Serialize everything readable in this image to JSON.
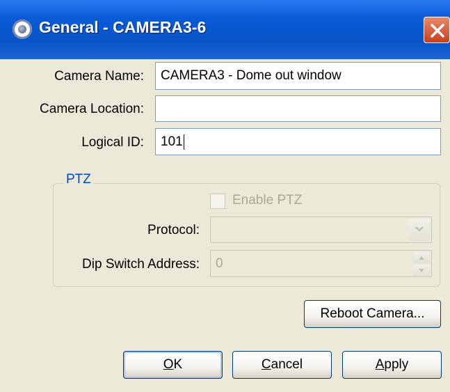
{
  "window": {
    "title": "General - CAMERA3-6",
    "icon": "camera-icon",
    "close_icon": "close-icon"
  },
  "form": {
    "camera_name_label": "Camera Name:",
    "camera_name_value": "CAMERA3 - Dome out window",
    "camera_location_label": "Camera Location:",
    "camera_location_value": "",
    "logical_id_label": "Logical ID:",
    "logical_id_value": "101"
  },
  "ptz": {
    "group_label": "PTZ",
    "enable_label": "Enable PTZ",
    "enable_checked": false,
    "protocol_label": "Protocol:",
    "protocol_value": "",
    "dip_label": "Dip Switch Address:",
    "dip_value": "0"
  },
  "buttons": {
    "reboot_label": "Reboot Camera...",
    "ok_mnemonic": "O",
    "ok_rest": "K",
    "cancel_mnemonic": "C",
    "cancel_rest": "ancel",
    "apply_mnemonic": "A",
    "apply_rest": "pply"
  },
  "colors": {
    "titlebar": "#0853c8",
    "dialog_bg": "#ece9d8",
    "group_label": "#0046d5",
    "close_button": "#c6401a"
  }
}
